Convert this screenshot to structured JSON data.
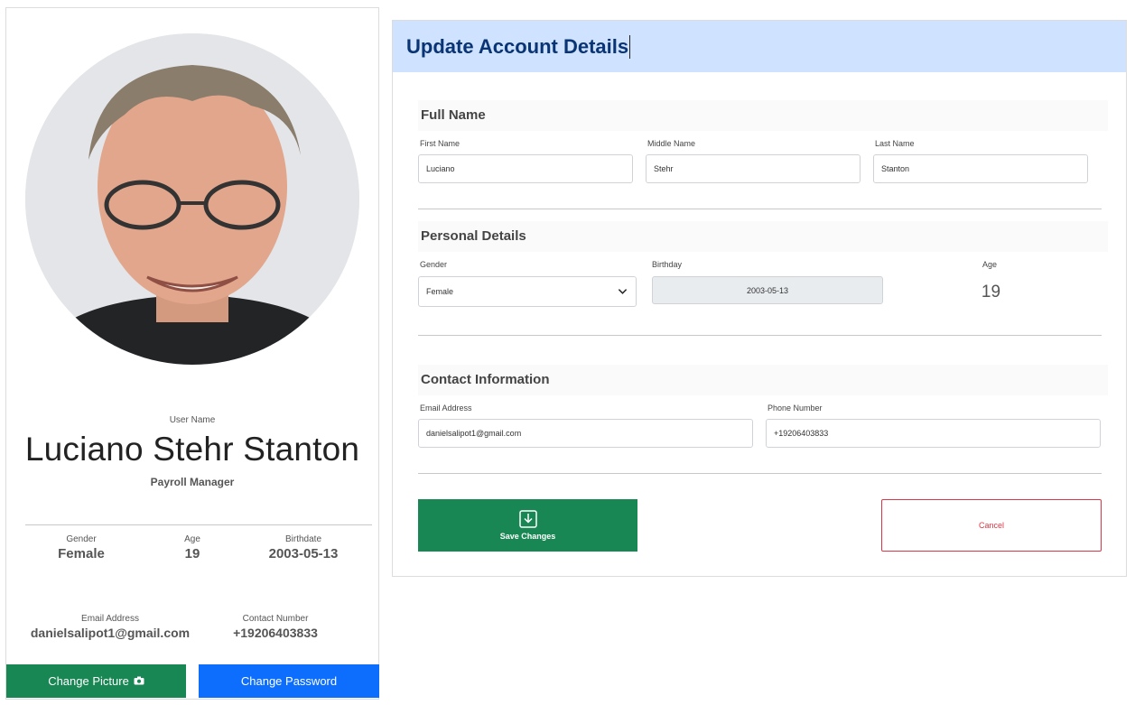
{
  "profile": {
    "username_label": "User Name",
    "full_name": "Luciano Stehr Stanton",
    "position": "Payroll Manager",
    "gender_label": "Gender",
    "gender": "Female",
    "age_label": "Age",
    "age": "19",
    "birthdate_label": "Birthdate",
    "birthdate": "2003-05-13",
    "email_label": "Email Address",
    "email": "danielsalipot1@gmail.com",
    "contact_label": "Contact Number",
    "contact": "+19206403833",
    "change_picture_label": "Change Picture",
    "change_password_label": "Change Password"
  },
  "form": {
    "title": "Update Account Details",
    "full_name_section": "Full Name",
    "first_name_label": "First Name",
    "first_name": "Luciano",
    "middle_name_label": "Middle Name",
    "middle_name": "Stehr",
    "last_name_label": "Last Name",
    "last_name": "Stanton",
    "personal_section": "Personal Details",
    "gender_label": "Gender",
    "gender_value": "Female",
    "birthday_label": "Birthday",
    "birthday_value": "2003-05-13",
    "age_label": "Age",
    "age_value": "19",
    "contact_section": "Contact Information",
    "email_label": "Email Address",
    "email_value": "danielsalipot1@gmail.com",
    "phone_label": "Phone Number",
    "phone_value": "+19206403833",
    "save_label": "Save Changes",
    "cancel_label": "Cancel"
  },
  "colors": {
    "save": "#198754",
    "password": "#0d6efd",
    "cancel": "#dc3545",
    "header_bg": "#cfe2ff",
    "title": "#0a3575"
  },
  "icons": {
    "change_picture": "camera-icon",
    "save": "download-icon",
    "gender_select": "chevron-down-icon"
  }
}
